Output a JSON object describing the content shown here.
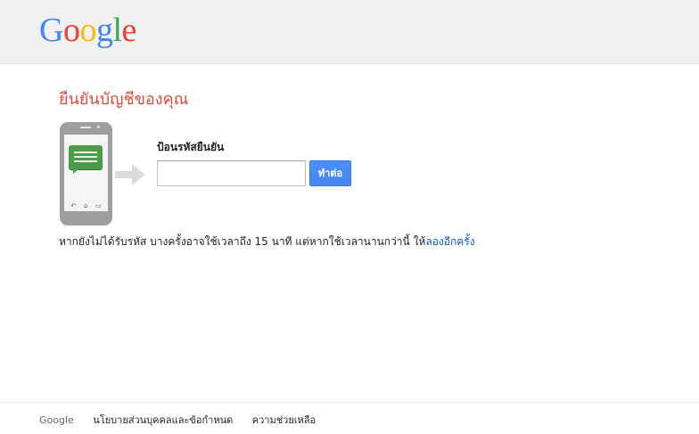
{
  "header": {
    "logo_letters": [
      "G",
      "o",
      "o",
      "g",
      "l",
      "e"
    ],
    "logo_colors": [
      "#4285f4",
      "#ea4335",
      "#fbbc05",
      "#4285f4",
      "#34a853",
      "#ea4335"
    ]
  },
  "main": {
    "title": "ยืนยันบัญชีของคุณ",
    "field_label": "ป้อนรหัสยืนยัน",
    "code_input": {
      "value": "",
      "placeholder": ""
    },
    "next_button": "ทำต่อ",
    "hint_text": "หากยังไม่ได้รับรหัส บางครั้งอาจใช้เวลาถึง 15 นาที แต่หากใช้เวลานานกว่านี้ ให้",
    "retry_link": "ลองอีกครั้ง"
  },
  "illustration": {
    "icons": [
      "phone-icon",
      "sms-message-icon",
      "arrow-right-icon"
    ]
  },
  "footer": {
    "brand": "Google",
    "privacy_link": "นโยบายส่วนบุคคลและข้อกำหนด",
    "help_link": "ความช่วยเหลือ"
  },
  "colors": {
    "title_red": "#dd4b39",
    "button_blue": "#4d90fe",
    "link_blue": "#1155cc",
    "header_bg": "#f1f1f1"
  }
}
